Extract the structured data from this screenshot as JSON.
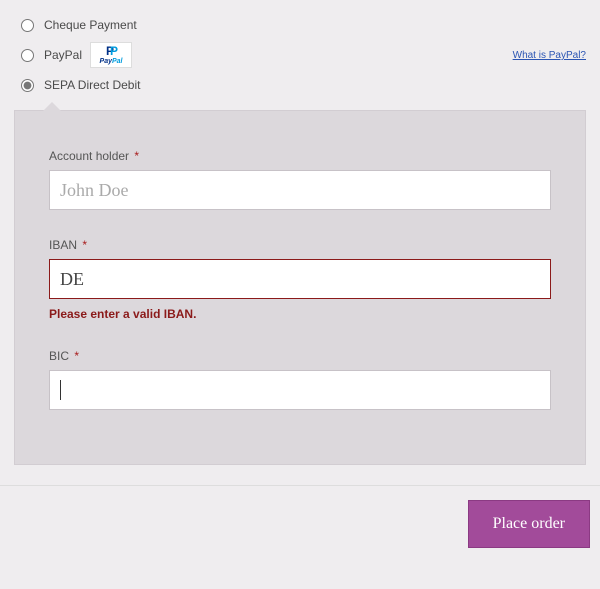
{
  "payment_methods": {
    "cheque": {
      "label": "Cheque Payment"
    },
    "paypal": {
      "label": "PayPal",
      "help_link": "What is PayPal?"
    },
    "sepa": {
      "label": "SEPA Direct Debit"
    }
  },
  "sepa_form": {
    "account_holder": {
      "label": "Account holder",
      "placeholder": "John Doe",
      "value": ""
    },
    "iban": {
      "label": "IBAN",
      "value": "DE",
      "error": "Please enter a valid IBAN."
    },
    "bic": {
      "label": "BIC",
      "value": ""
    }
  },
  "buttons": {
    "place_order": "Place order"
  },
  "required_mark": "*"
}
